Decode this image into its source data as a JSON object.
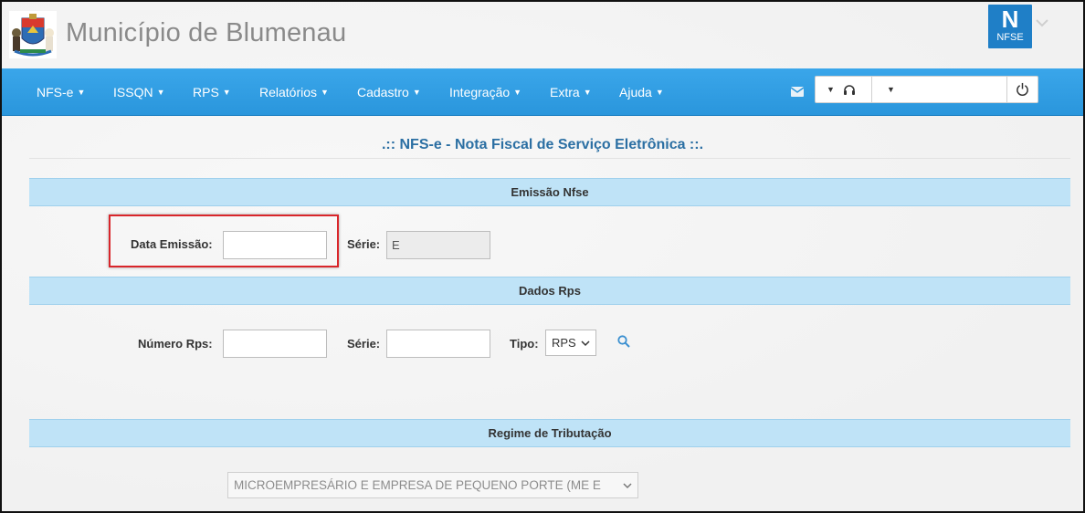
{
  "header": {
    "title": "Município de Blumenau",
    "logo_big": "N",
    "logo_small": "NFSE"
  },
  "nav": {
    "items": [
      {
        "label": "NFS-e"
      },
      {
        "label": "ISSQN"
      },
      {
        "label": "RPS"
      },
      {
        "label": "Relatórios"
      },
      {
        "label": "Cadastro"
      },
      {
        "label": "Integração"
      },
      {
        "label": "Extra"
      },
      {
        "label": "Ajuda"
      }
    ],
    "tools": [
      "envelope-icon",
      "headset-icon",
      "power-icon"
    ]
  },
  "page": {
    "heading": ".:: NFS-e - Nota Fiscal de Serviço Eletrônica ::."
  },
  "emissao": {
    "title": "Emissão Nfse",
    "data_label": "Data Emissão:",
    "data_value": "",
    "serie_label": "Série:",
    "serie_value": "E"
  },
  "rps": {
    "title": "Dados Rps",
    "numero_label": "Número Rps:",
    "numero_value": "",
    "serie_label": "Série:",
    "serie_value": "",
    "tipo_label": "Tipo:",
    "tipo_value": "RPS"
  },
  "regime": {
    "title": "Regime de Tributação",
    "value": "MICROEMPRESÁRIO E EMPRESA DE PEQUENO PORTE (ME E"
  },
  "colors": {
    "navbar": "#2a96dc",
    "section_bar": "#bfe3f7",
    "heading": "#2b6fa3",
    "highlight": "#d9262b",
    "logo": "#1f7fc7"
  }
}
